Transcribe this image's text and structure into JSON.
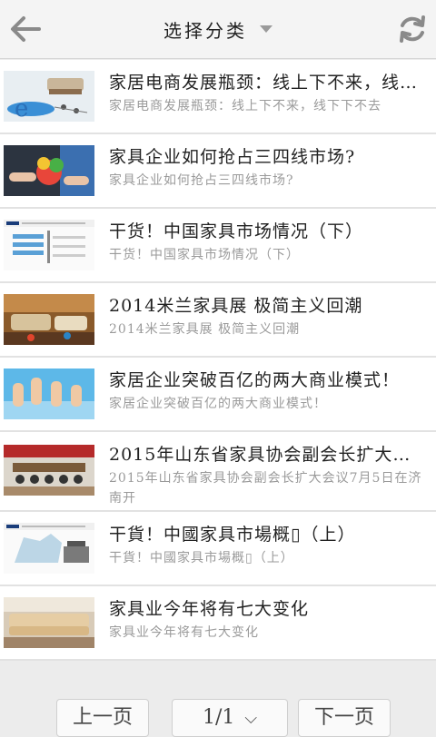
{
  "header": {
    "title": "选择分类",
    "back_icon": "arrow-left-icon",
    "refresh_icon": "refresh-icon",
    "dropdown_icon": "caret-down-icon"
  },
  "articles": [
    {
      "title": "家居电商发展瓶颈：线上下不来，线下下不去",
      "summary": "家居电商发展瓶颈：线上下不来，线下下不去"
    },
    {
      "title": "家具企业如何抢占三四线市场?",
      "summary": "家具企业如何抢占三四线市场?"
    },
    {
      "title": "干货！中国家具市场情况（下）",
      "summary": "干货！中国家具市场情况（下）"
    },
    {
      "title": "2014米兰家具展 极简主义回潮",
      "summary": "2014米兰家具展 极简主义回潮"
    },
    {
      "title": "家居企业突破百亿的两大商业模式！",
      "summary": "家居企业突破百亿的两大商业模式！"
    },
    {
      "title": "2015年山东省家具协会副会长扩大会议7月5日在济南开",
      "summary": "2015年山东省家具协会副会长扩大会议7月5日在济南开"
    },
    {
      "title": "干貨！中國家具市場概▯（上）",
      "summary": "干貨！中國家具市場概▯（上）"
    },
    {
      "title": "家具业今年将有七大变化",
      "summary": "家具业今年将有七大变化"
    }
  ],
  "pager": {
    "prev_label": "上一页",
    "page_label": "1/1",
    "next_label": "下一页"
  }
}
